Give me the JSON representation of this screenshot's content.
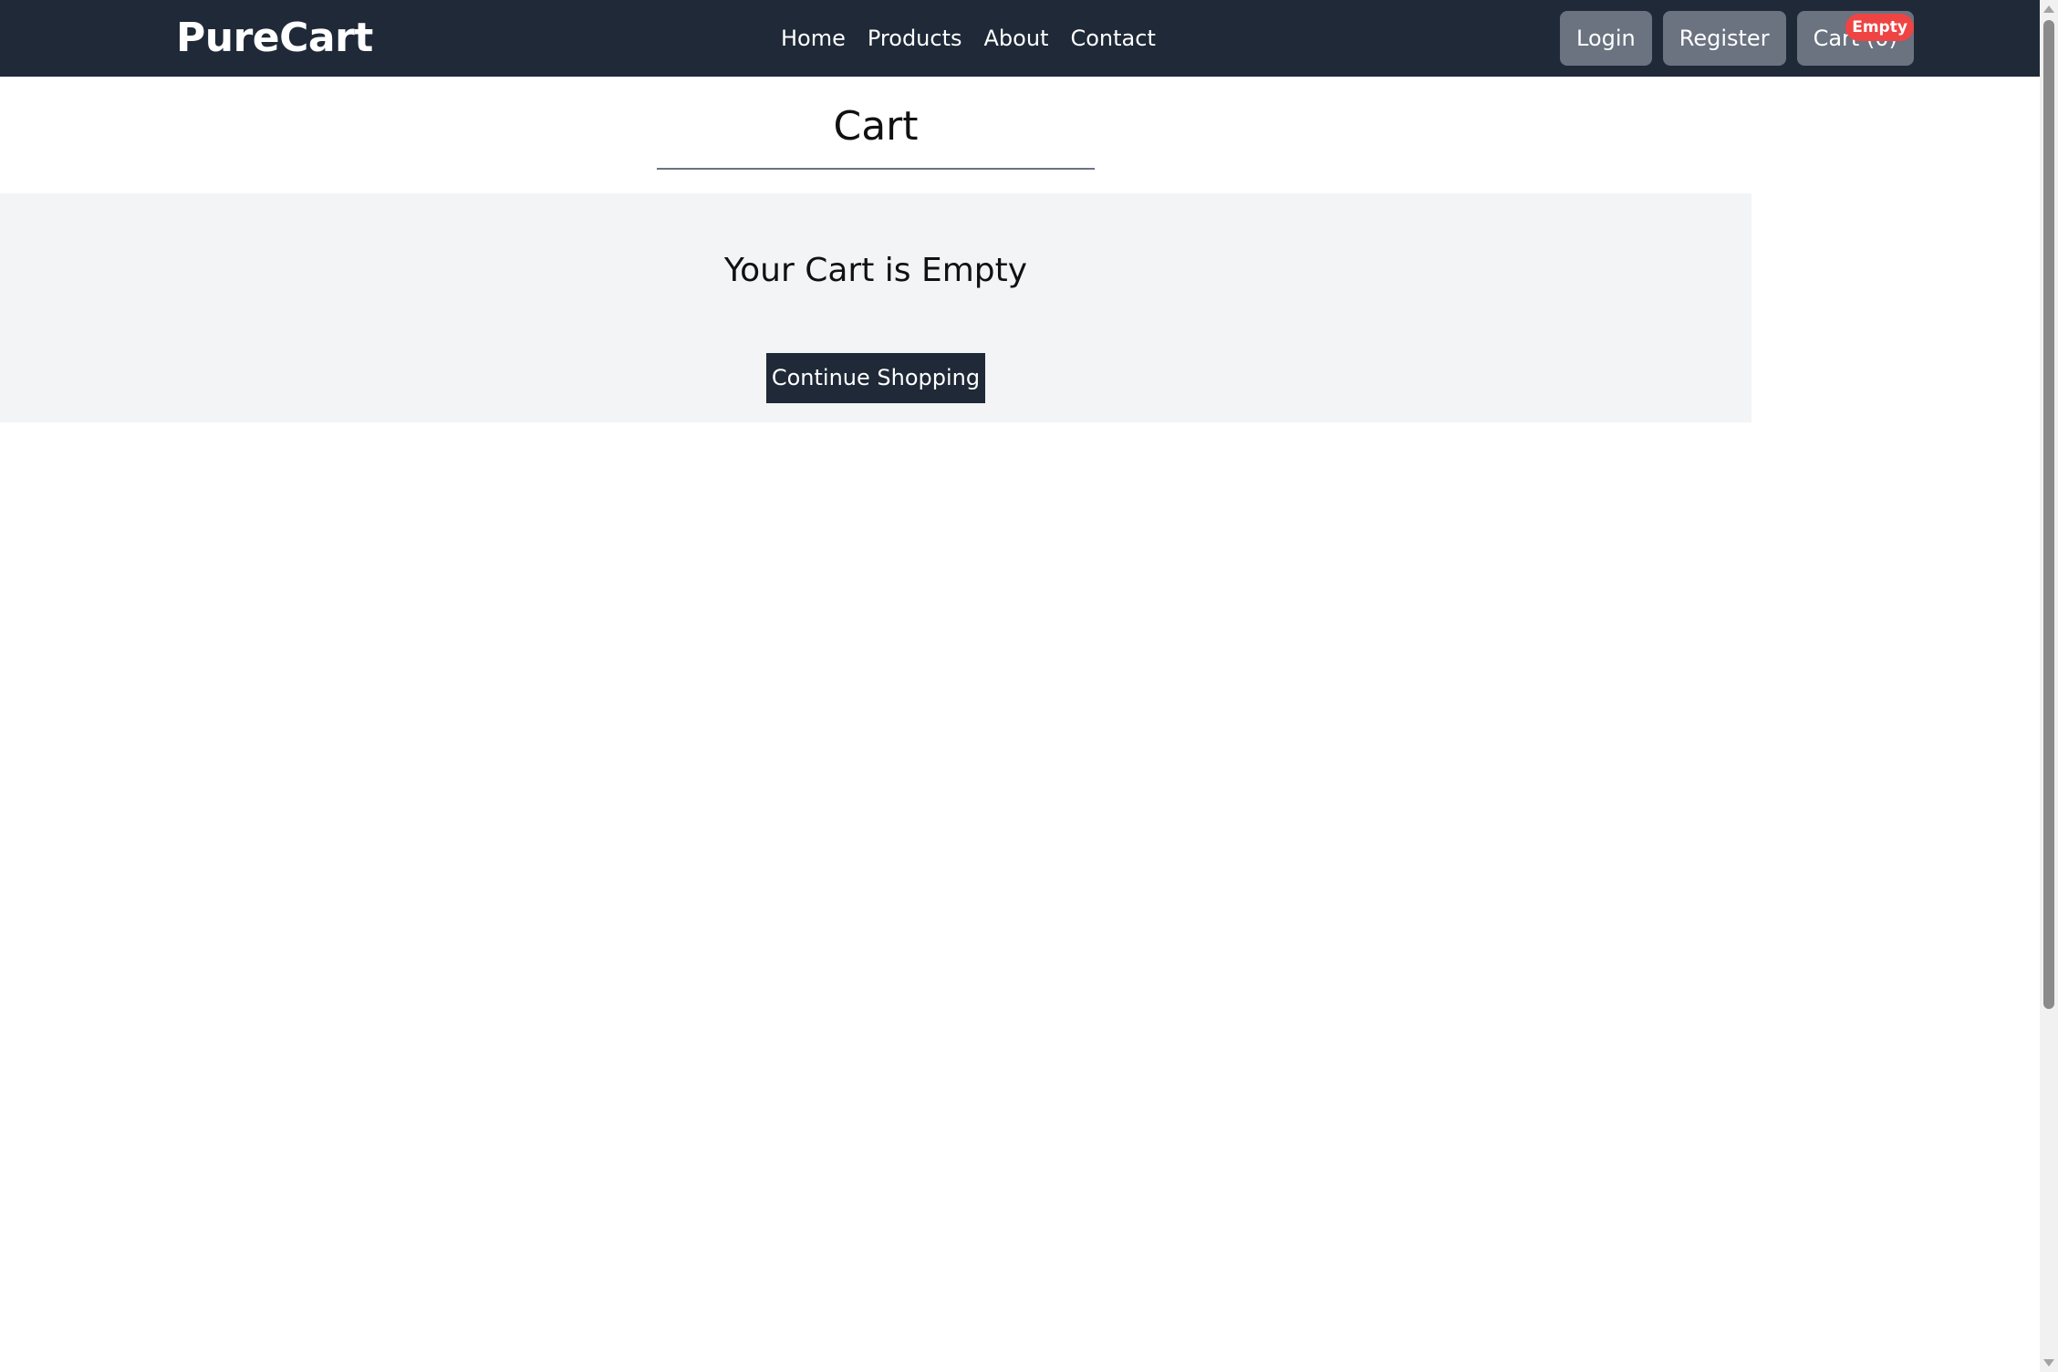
{
  "navbar": {
    "brand": "PureCart",
    "links": [
      {
        "label": "Home"
      },
      {
        "label": "Products"
      },
      {
        "label": "About"
      },
      {
        "label": "Contact"
      }
    ],
    "login_label": "Login",
    "register_label": "Register",
    "cart_label": "Cart (0)",
    "cart_badge": "Empty"
  },
  "main": {
    "title": "Cart",
    "empty_message": "Your Cart is Empty",
    "continue_label": "Continue Shopping"
  },
  "colors": {
    "navbar_bg": "#1f2937",
    "nav_button_bg": "#6b7280",
    "badge_bg": "#ef4444",
    "panel_bg": "#f3f4f6",
    "primary_button_bg": "#1f2937"
  }
}
